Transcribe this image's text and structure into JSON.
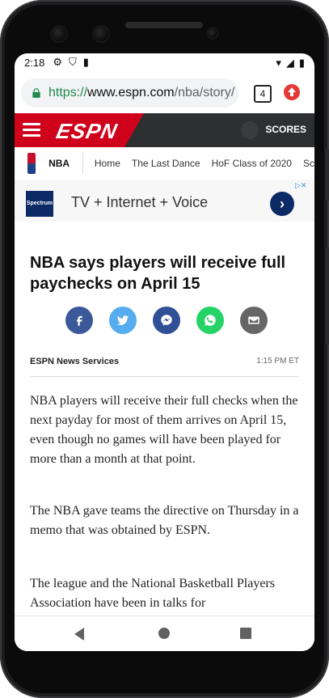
{
  "device": {
    "status": {
      "time": "2:18"
    },
    "colors": {
      "chrome_bg": "#f1f3f4",
      "secure": "#1f8a4c",
      "espn_red": "#d0021b",
      "espn_dark": "#2e2f31"
    }
  },
  "browser": {
    "url_secure_part": "https://",
    "url_host_part": "www.espn.com",
    "url_rest_part": "/nba/story/",
    "tabs_count": "4",
    "icons": {
      "lock": "lock-icon",
      "tabs": "tabs-count-icon",
      "upload": "update-icon"
    }
  },
  "espn": {
    "logo": "ESPN",
    "scores_label": "SCORES",
    "subnav": {
      "title": "NBA",
      "items": [
        "Home",
        "The Last Dance",
        "HoF Class of 2020",
        "Sc"
      ]
    }
  },
  "ad": {
    "brand": "Spectrum",
    "text": "TV + Internet + Voice",
    "adchoices": "▷✕"
  },
  "article": {
    "headline": "NBA says players will receive full paychecks on April 15",
    "byline_left": "ESPN News Services",
    "byline_right": "1:15 PM ET",
    "paragraphs": [
      "NBA players will receive their full checks when the next payday for most of them arrives on April 15, even though no games will have been played for more than a month at that point.",
      "The NBA gave teams the directive on Thursday in a memo that was obtained by ESPN.",
      "The league and the National Basketball Players Association have been in talks for"
    ]
  },
  "share": {
    "facebook": "#3b5998",
    "twitter": "#55acee",
    "messenger": "#2f4f96",
    "whatsapp": "#25d366",
    "email": "#666666"
  }
}
